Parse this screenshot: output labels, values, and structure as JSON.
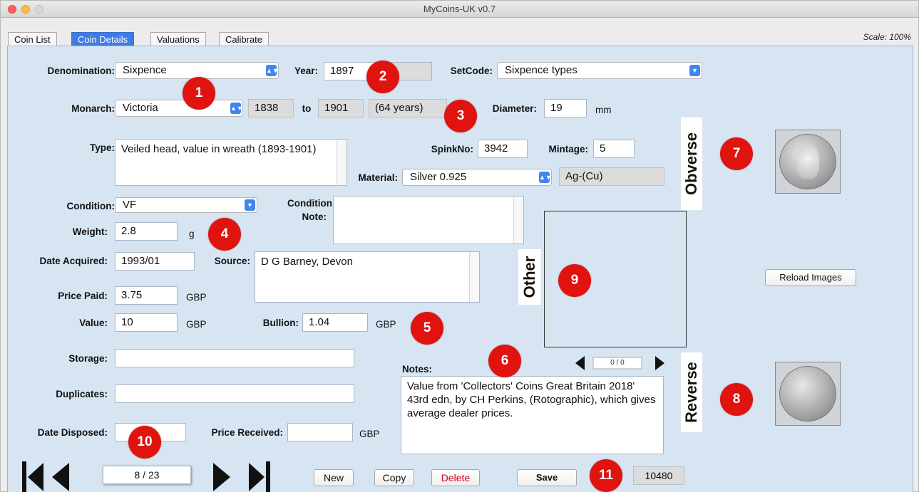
{
  "window": {
    "title": "MyCoins-UK v0.7"
  },
  "tabs": [
    {
      "label": "Coin List"
    },
    {
      "label": "Coin Details"
    },
    {
      "label": "Valuations"
    },
    {
      "label": "Calibrate"
    }
  ],
  "scale_text": "Scale:  100%",
  "labels": {
    "denomination": "Denomination:",
    "year": "Year:",
    "setcode": "SetCode:",
    "monarch": "Monarch:",
    "to": "to",
    "diameter": "Diameter:",
    "type": "Type:",
    "spinkno": "SpinkNo:",
    "mintage": "Mintage:",
    "material": "Material:",
    "condition": "Condition:",
    "condition_note_1": "Condition",
    "condition_note_2": "Note:",
    "weight": "Weight:",
    "date_acquired": "Date Acquired:",
    "source": "Source:",
    "price_paid": "Price Paid:",
    "value": "Value:",
    "bullion": "Bullion:",
    "storage": "Storage:",
    "notes": "Notes:",
    "duplicates": "Duplicates:",
    "date_disposed": "Date Disposed:",
    "price_received": "Price Received:"
  },
  "fields": {
    "denomination": "Sixpence",
    "year": "1897",
    "setcode": "Sixpence types",
    "monarch": "Victoria",
    "reign_start": "1838",
    "reign_end": "1901",
    "reign_length": "(64 years)",
    "diameter": "19",
    "diameter_unit": "mm",
    "type": "Veiled head, value in wreath (1893-1901)",
    "spinkno": "3942",
    "mintage": "5",
    "material": "Silver 0.925",
    "material_code": "Ag-(Cu)",
    "condition": "VF",
    "condition_note": "",
    "weight": "2.8",
    "weight_unit": "g",
    "date_acquired": "1993/01",
    "source": "D G Barney, Devon",
    "price_paid": "3.75",
    "price_paid_unit": "GBP",
    "value": "10",
    "value_unit": "GBP",
    "bullion": "1.04",
    "bullion_unit": "GBP",
    "storage": "",
    "notes": "Value from 'Collectors' Coins Great Britain 2018' 43rd edn, by CH Perkins, (Rotographic), which gives average dealer prices.",
    "duplicates": "",
    "date_disposed": "",
    "price_received": "",
    "price_received_unit": "GBP"
  },
  "image_labels": {
    "obverse": "Obverse",
    "other": "Other",
    "reverse": "Reverse"
  },
  "other_image_counter": "0 / 0",
  "buttons": {
    "reload_images": "Reload Images",
    "new": "New",
    "copy": "Copy",
    "delete": "Delete",
    "save": "Save"
  },
  "record_position": "8 / 23",
  "record_id": "10480",
  "markers": [
    "1",
    "2",
    "3",
    "4",
    "5",
    "6",
    "7",
    "8",
    "9",
    "10",
    "11"
  ],
  "colors": {
    "panel_bg": "#d7e5f3",
    "tab_active": "#3f7be3",
    "marker": "#e0130e",
    "delete_text": "#d0021b"
  }
}
